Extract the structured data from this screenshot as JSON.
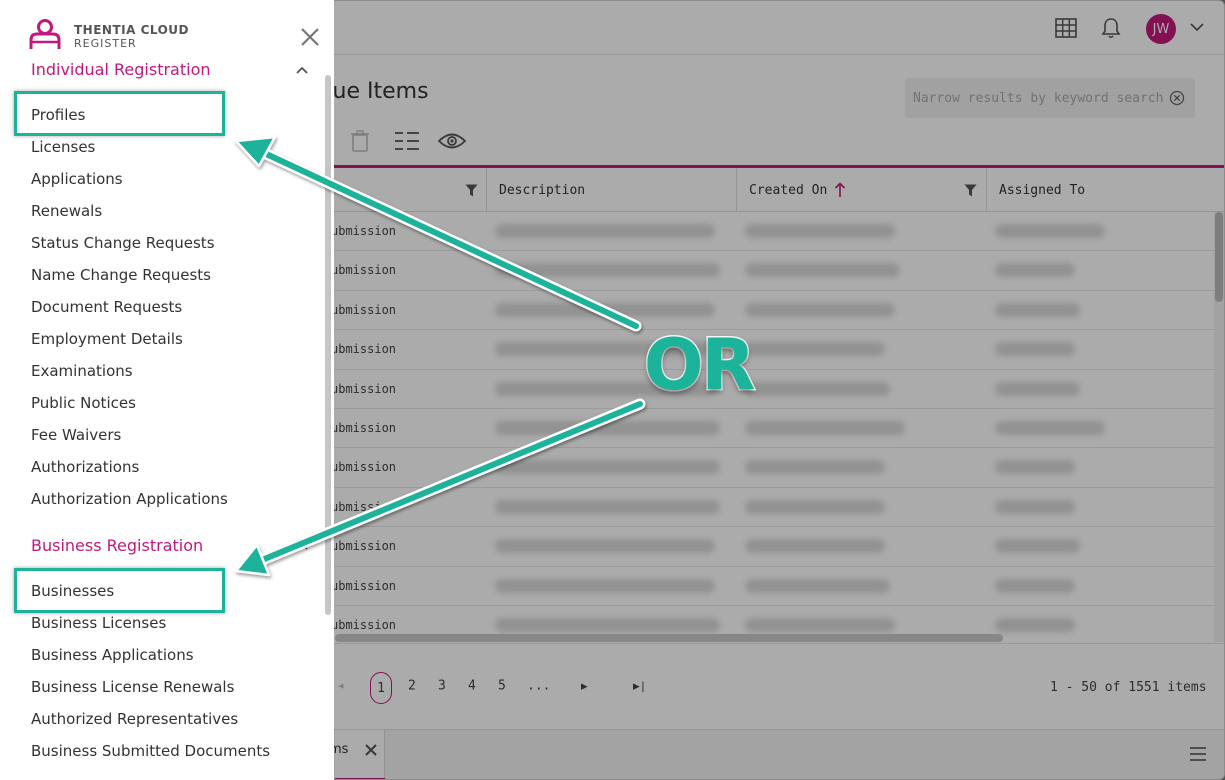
{
  "header": {
    "avatar_initials": "JW"
  },
  "page": {
    "title": "eue Items",
    "search_placeholder": "Narrow results by keyword search"
  },
  "grid": {
    "columns": [
      "Description",
      "Created On",
      "Assigned To"
    ],
    "row_type_label": "ubmission",
    "row_count": 11
  },
  "pager": {
    "pages": [
      "1",
      "2",
      "3",
      "4",
      "5",
      "..."
    ],
    "current_page": "1",
    "info": "1 - 50 of 1551 items"
  },
  "bottom_tab": {
    "label": "ms"
  },
  "drawer": {
    "logo_line1": "THENTIA CLOUD",
    "logo_line2": "REGISTER",
    "individual": {
      "title": "Individual Registration",
      "items": [
        "Profiles",
        "Licenses",
        "Applications",
        "Renewals",
        "Status Change Requests",
        "Name Change Requests",
        "Document Requests",
        "Employment Details",
        "Examinations",
        "Public Notices",
        "Fee Waivers",
        "Authorizations",
        "Authorization Applications"
      ]
    },
    "business": {
      "title": "Business Registration",
      "items": [
        "Businesses",
        "Business Licenses",
        "Business Applications",
        "Business License Renewals",
        "Authorized Representatives",
        "Business Submitted Documents"
      ]
    }
  },
  "annotation": {
    "text": "OR"
  },
  "colors": {
    "brand": "#c2187d",
    "callout": "#1bb39a"
  }
}
